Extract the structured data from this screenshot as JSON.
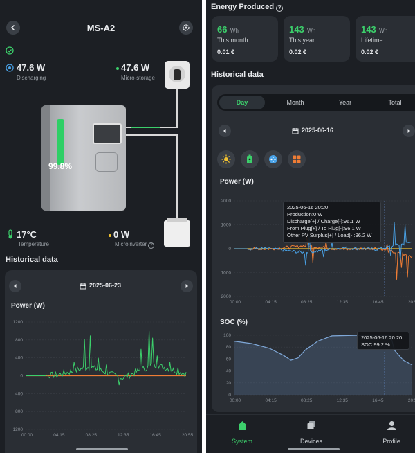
{
  "left": {
    "title": "MS-A2",
    "discharging": {
      "value": "47.6 W",
      "label": "Discharging"
    },
    "micro_storage": {
      "value": "47.6 W",
      "label": "Micro-storage"
    },
    "soc_display": "99.8%",
    "temperature": {
      "value": "17°C",
      "label": "Temperature"
    },
    "microinverter": {
      "value": "0 W",
      "label": "Microinverter"
    },
    "historical_title": "Historical data",
    "date": "2025-06-23",
    "power_title": "Power (W)",
    "y_ticks": [
      "1200",
      "800",
      "400",
      "0",
      "400",
      "800",
      "1200"
    ],
    "x_ticks": [
      "00:00",
      "04:15",
      "08:25",
      "12:35",
      "16:45",
      "20:55"
    ]
  },
  "right": {
    "energy_title": "Energy Produced",
    "stats": [
      {
        "value": "66",
        "unit": "Wh",
        "label": "This month",
        "money": "0.01 €"
      },
      {
        "value": "143",
        "unit": "Wh",
        "label": "This year",
        "money": "0.02 €"
      },
      {
        "value": "143",
        "unit": "Wh",
        "label": "Lifetime",
        "money": "0.02 €"
      }
    ],
    "historical_title": "Historical data",
    "tabs": [
      "Day",
      "Month",
      "Year",
      "Total"
    ],
    "active_tab": "Day",
    "date": "2025-06-16",
    "power_title": "Power (W)",
    "power_y_ticks": [
      "2000",
      "1000",
      "0",
      "1000",
      "2000"
    ],
    "tooltip": [
      "2025-06-16 20:20",
      "Production:0 W",
      "Discharge[+] / Charge[-]:96.1 W",
      "From Plug[+] / To Plug[-]:96.1 W",
      "Other PV Surplus[+] / Load[-]:96.2 W"
    ],
    "soc_title": "SOC (%)",
    "soc_y_ticks": [
      "100",
      "80",
      "60",
      "40",
      "20",
      "0"
    ],
    "soc_tooltip": [
      "2025-06-16 20:20",
      "SOC:99.2 %"
    ],
    "x_ticks": [
      "00:00",
      "04:15",
      "08:25",
      "12:35",
      "16:45",
      "20:55"
    ],
    "nav": [
      {
        "label": "System",
        "active": true
      },
      {
        "label": "Devices",
        "active": false
      },
      {
        "label": "Profile",
        "active": false
      }
    ]
  },
  "colors": {
    "accent": "#3ccf6b",
    "discharge": "#4aa3e8",
    "charge": "#ef7d35",
    "soc": "#7fa8d8"
  },
  "chart_data": [
    {
      "type": "line",
      "title": "Power (W)",
      "ylim": [
        -1200,
        1200
      ],
      "x": [
        "00:00",
        "04:15",
        "08:25",
        "12:35",
        "16:45",
        "20:55"
      ],
      "series": [
        {
          "values": [
            0,
            60,
            820,
            -210,
            1000,
            180
          ]
        }
      ]
    },
    {
      "type": "line",
      "title": "Power (W)",
      "ylim": [
        -2000,
        2000
      ],
      "x": [
        "00:00",
        "04:15",
        "08:25",
        "12:35",
        "16:45",
        "20:55"
      ],
      "series": [
        {
          "values": [
            0,
            20,
            -700,
            150,
            -100,
            1100
          ]
        },
        {
          "values": [
            0,
            -30,
            500,
            -120,
            80,
            -1300
          ]
        }
      ]
    },
    {
      "type": "area",
      "title": "SOC (%)",
      "ylim": [
        0,
        100
      ],
      "x": [
        "00:00",
        "04:15",
        "08:25",
        "12:35",
        "16:45",
        "20:55"
      ],
      "series": [
        {
          "values": [
            90,
            80,
            62,
            99,
            100,
            60
          ]
        }
      ]
    }
  ]
}
